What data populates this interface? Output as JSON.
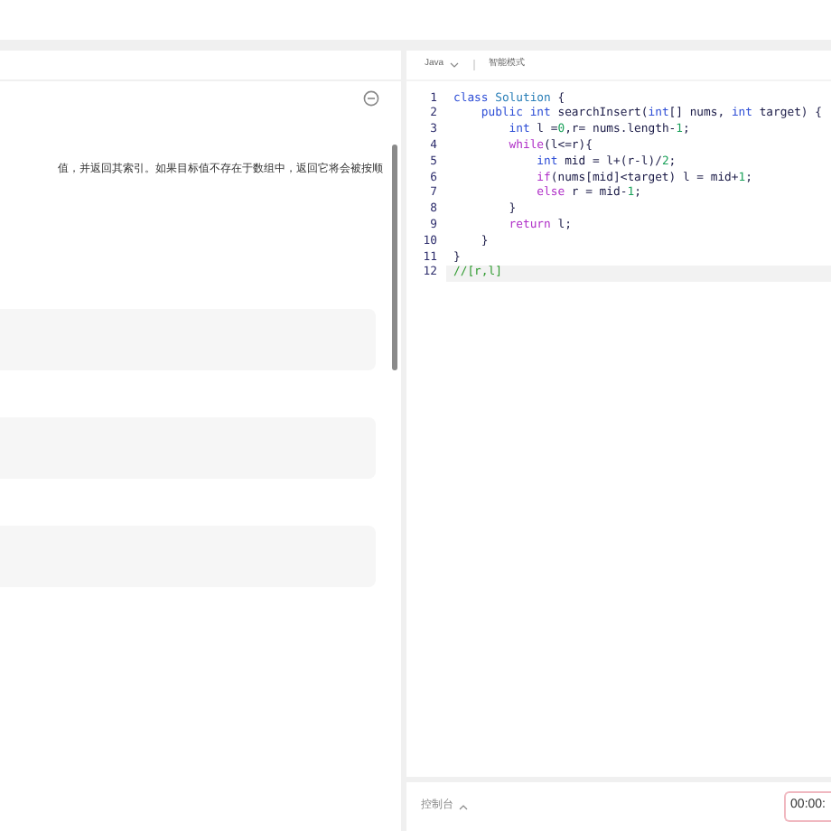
{
  "problem": {
    "description": "值，并返回其索引。如果目标值不存在于数组中，返回它将会被按顺"
  },
  "editor": {
    "language": "Java",
    "mode": "智能模式",
    "lines": [
      {
        "number": "1",
        "selected": false,
        "tokens": [
          {
            "kind": "kw",
            "text": "class"
          },
          {
            "kind": "type",
            "text": " Solution"
          },
          {
            "kind": "text",
            "text": " {"
          }
        ]
      },
      {
        "number": "2",
        "selected": false,
        "tokens": [
          {
            "kind": "kw",
            "text": "    public int"
          },
          {
            "kind": "text",
            "text": " searchInsert("
          },
          {
            "kind": "kw",
            "text": "int"
          },
          {
            "kind": "text",
            "text": "[] nums, "
          },
          {
            "kind": "kw",
            "text": "int"
          },
          {
            "kind": "text",
            "text": " target) {"
          }
        ]
      },
      {
        "number": "3",
        "selected": false,
        "tokens": [
          {
            "kind": "kw",
            "text": "        int"
          },
          {
            "kind": "text",
            "text": " l ="
          },
          {
            "kind": "num",
            "text": "0"
          },
          {
            "kind": "text",
            "text": ",r= nums.length-"
          },
          {
            "kind": "num",
            "text": "1"
          },
          {
            "kind": "text",
            "text": ";"
          }
        ]
      },
      {
        "number": "4",
        "selected": false,
        "tokens": [
          {
            "kind": "ctrl",
            "text": "        while"
          },
          {
            "kind": "text",
            "text": "(l<=r){"
          }
        ]
      },
      {
        "number": "5",
        "selected": false,
        "tokens": [
          {
            "kind": "kw",
            "text": "            int"
          },
          {
            "kind": "text",
            "text": " mid = l+(r-l)/"
          },
          {
            "kind": "num",
            "text": "2"
          },
          {
            "kind": "text",
            "text": ";"
          }
        ]
      },
      {
        "number": "6",
        "selected": false,
        "tokens": [
          {
            "kind": "ctrl",
            "text": "            if"
          },
          {
            "kind": "text",
            "text": "(nums[mid]<target) l = mid+"
          },
          {
            "kind": "num",
            "text": "1"
          },
          {
            "kind": "text",
            "text": ";"
          }
        ]
      },
      {
        "number": "7",
        "selected": false,
        "tokens": [
          {
            "kind": "ctrl",
            "text": "            else"
          },
          {
            "kind": "text",
            "text": " r = mid-"
          },
          {
            "kind": "num",
            "text": "1"
          },
          {
            "kind": "text",
            "text": ";"
          }
        ]
      },
      {
        "number": "8",
        "selected": false,
        "tokens": [
          {
            "kind": "text",
            "text": "        }"
          }
        ]
      },
      {
        "number": "9",
        "selected": false,
        "tokens": [
          {
            "kind": "ctrl",
            "text": "        return"
          },
          {
            "kind": "text",
            "text": " l;"
          }
        ]
      },
      {
        "number": "10",
        "selected": false,
        "tokens": [
          {
            "kind": "text",
            "text": "    }"
          }
        ]
      },
      {
        "number": "11",
        "selected": false,
        "tokens": [
          {
            "kind": "text",
            "text": "}"
          }
        ]
      },
      {
        "number": "12",
        "selected": true,
        "tokens": [
          {
            "kind": "com",
            "text": "//[r,l]"
          }
        ]
      }
    ]
  },
  "console": {
    "label": "控制台",
    "timer": "00:00:"
  }
}
